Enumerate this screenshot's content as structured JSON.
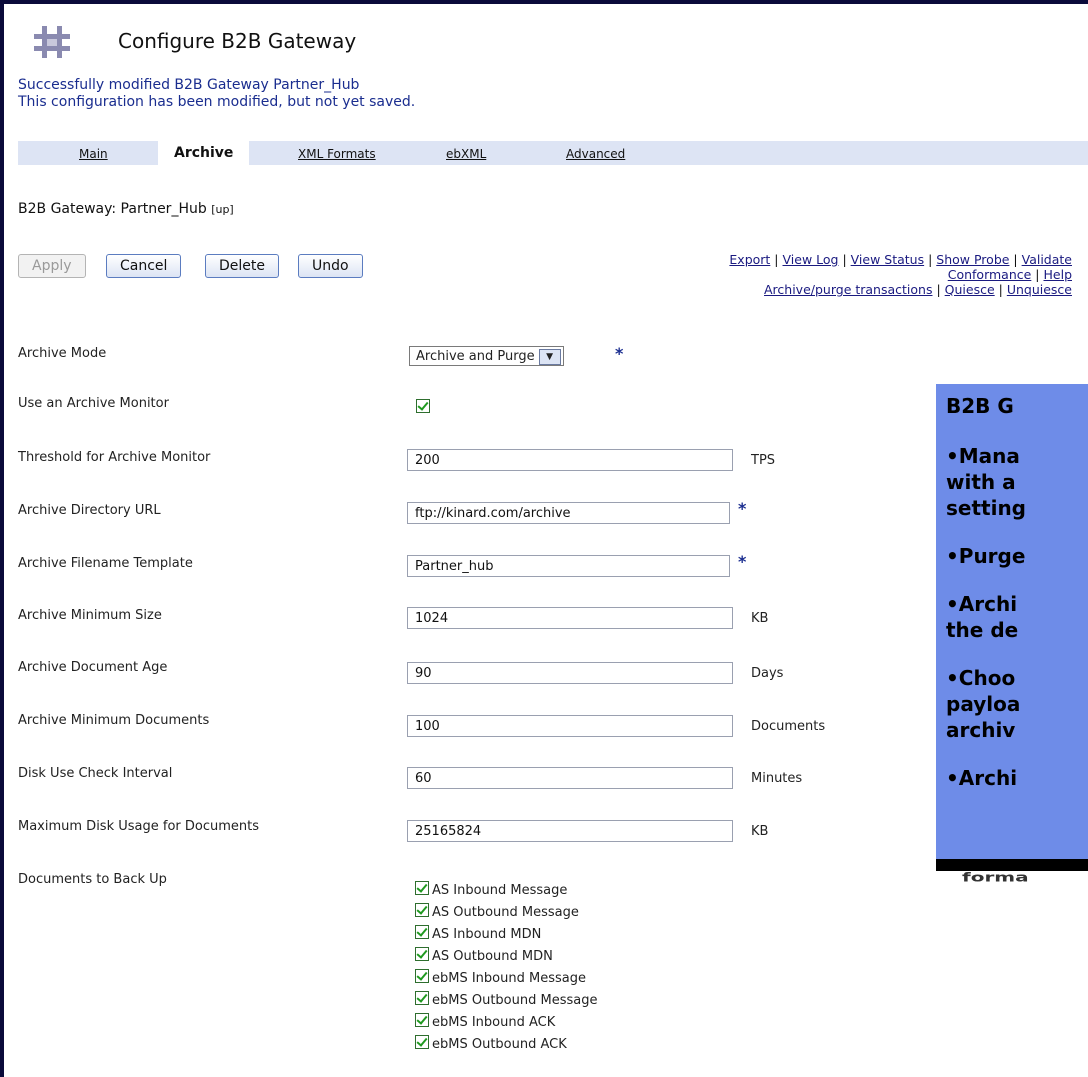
{
  "header": {
    "title": "Configure B2B Gateway",
    "logo_icon": "bridge-logo-icon"
  },
  "messages": [
    "Successfully modified B2B Gateway Partner_Hub",
    "This configuration has been modified, but not yet saved."
  ],
  "tabs": [
    "Main",
    "Archive",
    "XML Formats",
    "ebXML",
    "Advanced"
  ],
  "active_tab": "Archive",
  "gateway": {
    "label": "B2B Gateway: Partner_Hub",
    "status": "[up]"
  },
  "buttons": {
    "apply": "Apply",
    "cancel": "Cancel",
    "delete": "Delete",
    "undo": "Undo"
  },
  "links": {
    "export": "Export",
    "view_log": "View Log",
    "view_status": "View Status",
    "show_probe": "Show Probe",
    "validate": "Validate",
    "conformance": "Conformance",
    "help": "Help",
    "archive_purge": "Archive/purge transactions",
    "quiesce": "Quiesce",
    "unquiesce": "Unquiesce"
  },
  "form": {
    "archive_mode": {
      "label": "Archive Mode",
      "value": "Archive and Purge"
    },
    "use_monitor": {
      "label": "Use an Archive Monitor",
      "checked": true
    },
    "threshold": {
      "label": "Threshold for Archive Monitor",
      "value": "200",
      "unit": "TPS"
    },
    "dir_url": {
      "label": "Archive Directory URL",
      "value": "ftp://kinard.com/archive"
    },
    "filename": {
      "label": "Archive Filename Template",
      "value": "Partner_hub"
    },
    "min_size": {
      "label": "Archive Minimum Size",
      "value": "1024",
      "unit": "KB"
    },
    "doc_age": {
      "label": "Archive Document Age",
      "value": "90",
      "unit": "Days"
    },
    "min_docs": {
      "label": "Archive Minimum Documents",
      "value": "100",
      "unit": "Documents"
    },
    "disk_interval": {
      "label": "Disk Use Check Interval",
      "value": "60",
      "unit": "Minutes"
    },
    "max_disk": {
      "label": "Maximum Disk Usage for Documents",
      "value": "25165824",
      "unit": "KB"
    },
    "docs_backup": {
      "label": "Documents to Back Up",
      "items": [
        "AS Inbound Message",
        "AS Outbound Message",
        "AS Inbound MDN",
        "AS Outbound MDN",
        "ebMS Inbound Message",
        "ebMS Outbound Message",
        "ebMS Inbound ACK",
        "ebMS Outbound ACK"
      ]
    }
  },
  "required_marker": "*",
  "panel": {
    "lines": [
      "B2B G",
      "•Mana",
      "with a",
      "setting",
      "•Purge",
      "•Archi",
      "the de",
      "•Choo",
      "payloa",
      "archiv",
      "•Archi"
    ],
    "overflow_text": "forma"
  },
  "colors": {
    "background": "#0a0a3a",
    "tabbar": "#dde4f4",
    "panel": "#6e8ce8",
    "message": "#1a2d8f"
  }
}
